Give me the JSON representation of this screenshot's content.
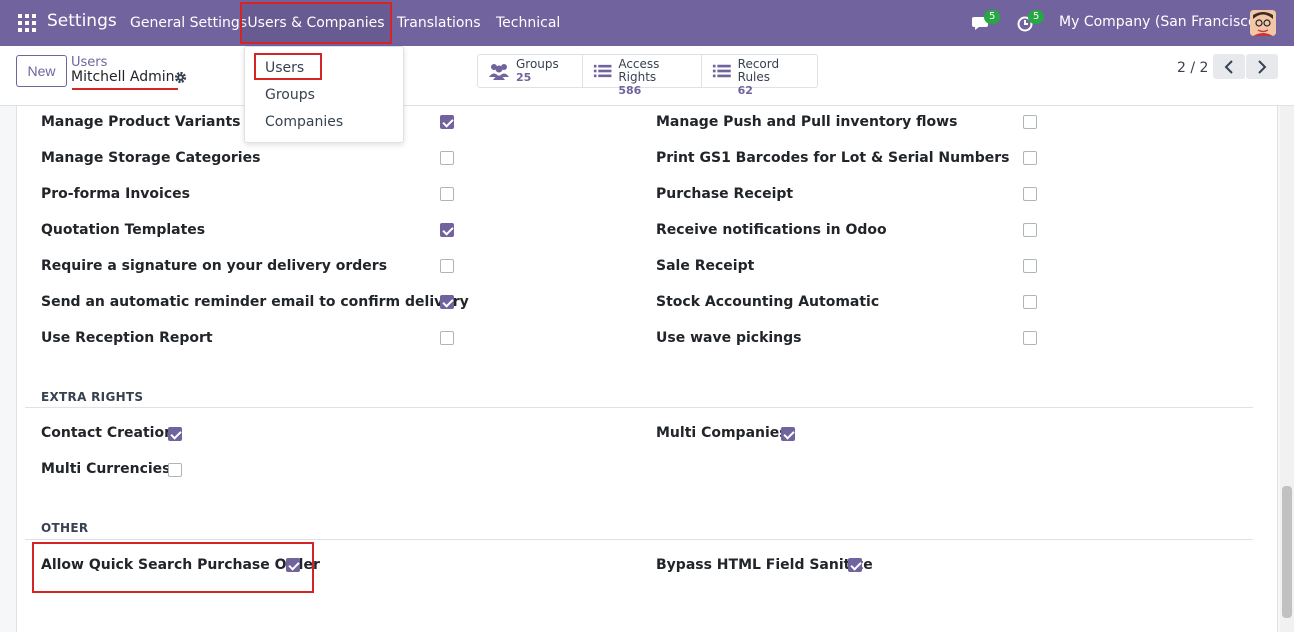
{
  "navbar": {
    "brand": "Settings",
    "menu": [
      "General Settings",
      "Users & Companies",
      "Translations",
      "Technical"
    ],
    "messages_count": "5",
    "activities_count": "5",
    "company": "My Company (San Francisco)"
  },
  "dropdown": {
    "items": [
      "Users",
      "Groups",
      "Companies"
    ]
  },
  "control": {
    "new_label": "New",
    "breadcrumb_parent": "Users",
    "breadcrumb_current": "Mitchell Admin",
    "stats": [
      {
        "label": "Groups",
        "value": "25"
      },
      {
        "label": "Access Rights",
        "value": "586"
      },
      {
        "label": "Record Rules",
        "value": "62"
      }
    ],
    "pager": "2 / 2"
  },
  "permissions": {
    "left": [
      {
        "label": "Manage Product Variants",
        "checked": true
      },
      {
        "label": "Manage Storage Categories",
        "checked": false
      },
      {
        "label": "Pro-forma Invoices",
        "checked": false
      },
      {
        "label": "Quotation Templates",
        "checked": true
      },
      {
        "label": "Require a signature on your delivery orders",
        "checked": false
      },
      {
        "label": "Send an automatic reminder email to confirm delivery",
        "checked": true
      },
      {
        "label": "Use Reception Report",
        "checked": false
      }
    ],
    "right": [
      {
        "label": "Manage Push and Pull inventory flows",
        "checked": false
      },
      {
        "label": "Print GS1 Barcodes for Lot & Serial Numbers",
        "checked": false
      },
      {
        "label": "Purchase Receipt",
        "checked": false
      },
      {
        "label": "Receive notifications in Odoo",
        "checked": false
      },
      {
        "label": "Sale Receipt",
        "checked": false
      },
      {
        "label": "Stock Accounting Automatic",
        "checked": false
      },
      {
        "label": "Use wave pickings",
        "checked": false
      }
    ]
  },
  "extra_rights": {
    "title": "EXTRA RIGHTS",
    "items": [
      {
        "label": "Contact Creation",
        "checked": true
      },
      {
        "label": "Multi Companies",
        "checked": true
      },
      {
        "label": "Multi Currencies",
        "checked": false
      }
    ]
  },
  "other": {
    "title": "OTHER",
    "items": [
      {
        "label": "Allow Quick Search Purchase Order",
        "checked": true
      },
      {
        "label": "Bypass HTML Field Sanitize",
        "checked": true
      }
    ]
  },
  "colors": {
    "brand": "#71639e",
    "highlight": "#d42426",
    "badge": "#28a745"
  }
}
